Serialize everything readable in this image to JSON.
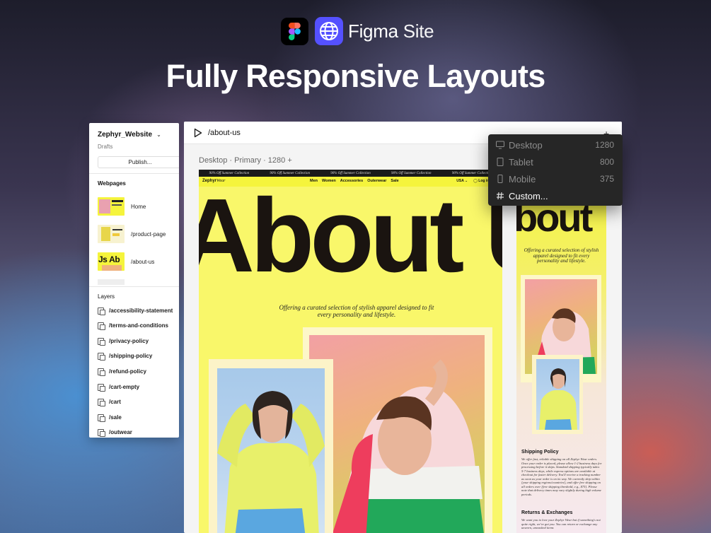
{
  "brand": {
    "name_primary": "Figma",
    "name_secondary": "Site"
  },
  "headline": "Fully Responsive Layouts",
  "left_panel": {
    "file_name": "Zephyr_Website",
    "drafts_label": "Drafts",
    "publish_label": "Publish...",
    "webpages_heading": "Webpages",
    "pages": [
      {
        "label": "Home"
      },
      {
        "label": "/product-page"
      },
      {
        "label": "/about-us"
      }
    ],
    "layers_heading": "Layers",
    "layers": [
      {
        "label": "/accessibility-statement"
      },
      {
        "label": "/terms-and-conditions"
      },
      {
        "label": "/privacy-policy"
      },
      {
        "label": "/shipping-policy"
      },
      {
        "label": "/refund-policy"
      },
      {
        "label": "/cart-empty"
      },
      {
        "label": "/cart"
      },
      {
        "label": "/sale"
      },
      {
        "label": "/outwear"
      }
    ]
  },
  "canvas": {
    "path": "/about-us",
    "breakpoint_label": "Desktop · Primary · 1280 +"
  },
  "site": {
    "promo": "90% Off Summer Collection",
    "logo_bold": "Zephyr",
    "logo_italic": "Wear",
    "nav_links": [
      "Men",
      "Women",
      "Accessories",
      "Outerwear",
      "Sale"
    ],
    "region": "USA",
    "login": "Log in",
    "hero_text": "About U",
    "tagline": "Offering a curated selection of stylish apparel designed to fit every personality and lifestyle."
  },
  "mobile": {
    "hero_text": "bout",
    "tagline": "Offering a curated selection of stylish apparel designed to fit every personality and lifestyle.",
    "shipping_heading": "Shipping Policy",
    "shipping_body": "We offer fast, reliable shipping on all Zephyr Wear orders. Once your order is placed, please allow 1-2 business days for processing before it ships. Standard shipping typically takes 5-7 business days, while express options are available at checkout for faster delivery. You'll receive a tracking number as soon as your order is on its way. We currently ship within [your shipping regions/countries], and offer free shipping on all orders over [free shipping threshold, e.g., $75]. Please note that delivery times may vary slightly during high volume periods.",
    "returns_heading": "Returns & Exchanges",
    "returns_body": "We want you to love your Zephyr Wear but if something's not quite right, we've got you. You can return or exchange any unworn, unwashed items"
  },
  "breakpoint_menu": [
    {
      "name": "Desktop",
      "value": "1280",
      "icon": "desktop-icon"
    },
    {
      "name": "Tablet",
      "value": "800",
      "icon": "tablet-icon"
    },
    {
      "name": "Mobile",
      "value": "375",
      "icon": "mobile-icon"
    },
    {
      "name": "Custom...",
      "value": "",
      "icon": "hash-icon"
    }
  ]
}
